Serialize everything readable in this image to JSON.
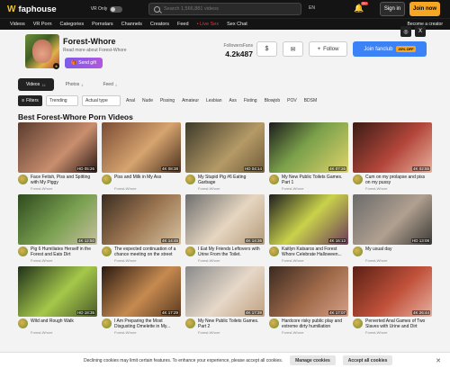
{
  "header": {
    "logo_text": "faphouse",
    "vr_toggle_label": "VR Only",
    "search_placeholder": "Search 1,566,881 videos",
    "language": "EN",
    "notification_count": "99+",
    "signin_label": "Sign in",
    "join_label": "Join now"
  },
  "nav": {
    "items": [
      "Videos",
      "VR Porn",
      "Categories",
      "Pornstars",
      "Channels",
      "Creators",
      "Feed",
      "• Live Sex",
      "Sex Chat"
    ],
    "become_creator": "Become a creator"
  },
  "profile": {
    "name": "Forest-Whore",
    "read_more": "Read more about Forest-Whore",
    "send_gift": "Send gift",
    "followers_label": "FollowersFans",
    "followers_count": "4.2k487",
    "follow_label": "Follow",
    "fanclub_label": "Join fanclub",
    "fanclub_discount": "20% OFF"
  },
  "tabs": [
    {
      "label": "Videos",
      "count": "14"
    },
    {
      "label": "Photos",
      "count": "4"
    },
    {
      "label": "Feed",
      "count": "1"
    }
  ],
  "filters": {
    "filter_label": "Filters",
    "sort_label": "Trending",
    "type_label": "Actual type",
    "chips": [
      "Anal",
      "Nude",
      "Pissing",
      "Amateur",
      "Lesbian",
      "Ass",
      "Fisting",
      "Blowjob",
      "POV",
      "BDSM"
    ]
  },
  "section_title": "Best Forest-Whore Porn Videos",
  "videos": [
    {
      "title": "Face Fetish, Piss and Spitting with My Piggy",
      "creator": "Forest-Whore",
      "duration": "HD 05:26"
    },
    {
      "title": "Piss and Milk in My Ass",
      "creator": "Forest-Whore",
      "duration": "4K 08:38"
    },
    {
      "title": "My Stupid Pig #6 Eating Garbage",
      "creator": "Forest-Whore",
      "duration": "HD 04:14"
    },
    {
      "title": "My New Public Toilets Games. Part 1",
      "creator": "Forest-Whore",
      "duration": "4K 07:26"
    },
    {
      "title": "Cum on my prolapse and piss on my pussy",
      "creator": "Forest-Whore",
      "duration": "4K 02:55"
    },
    {
      "title": "Pig 6 Humiliates Herself in the Forest and Eats Dirt",
      "creator": "Forest-Whore",
      "duration": "4K 12:50"
    },
    {
      "title": "The expected continuation of a chance meeting on the street",
      "creator": "Forest-Whore",
      "duration": "4K 14:45"
    },
    {
      "title": "I Eat My Friends Leftovers with Urine From the Toilet.",
      "creator": "Forest-Whore",
      "duration": "4K 14:36"
    },
    {
      "title": "Kaitlyn Katsaros and Forest Whore Celebrate Halloween...",
      "creator": "Forest-Whore",
      "duration": "4K 16:13"
    },
    {
      "title": "My usual day",
      "creator": "Forest-Whore",
      "duration": "HD 13:08"
    },
    {
      "title": "Wild and Rough Walk",
      "creator": "Forest-Whore",
      "duration": "HD 18:35"
    },
    {
      "title": "I Am Preparing the Most Disgusting Omelette in My...",
      "creator": "Forest-Whore",
      "duration": "4K 17:29"
    },
    {
      "title": "My New Public Toilets Games. Part 2",
      "creator": "Forest-Whore",
      "duration": "4K 17:39"
    },
    {
      "title": "Hardcore risky public play and extreme dirty humiliation",
      "creator": "Forest-Whore",
      "duration": "4K 17:07"
    },
    {
      "title": "Perverted Anal Games of Two Slaves with Urine and Dirt",
      "creator": "Forest-Whore",
      "duration": "4K 26:44"
    }
  ],
  "cookie": {
    "text": "Declining cookies may limit certain features. To enhance your experience, please accept all cookies.",
    "manage_label": "Manage cookies",
    "accept_label": "Accept all cookies"
  },
  "colors": {
    "accent": "#f5a623",
    "fanclub": "#3b82f6",
    "gift": "#8f5ce6",
    "header_bg": "#141414"
  }
}
